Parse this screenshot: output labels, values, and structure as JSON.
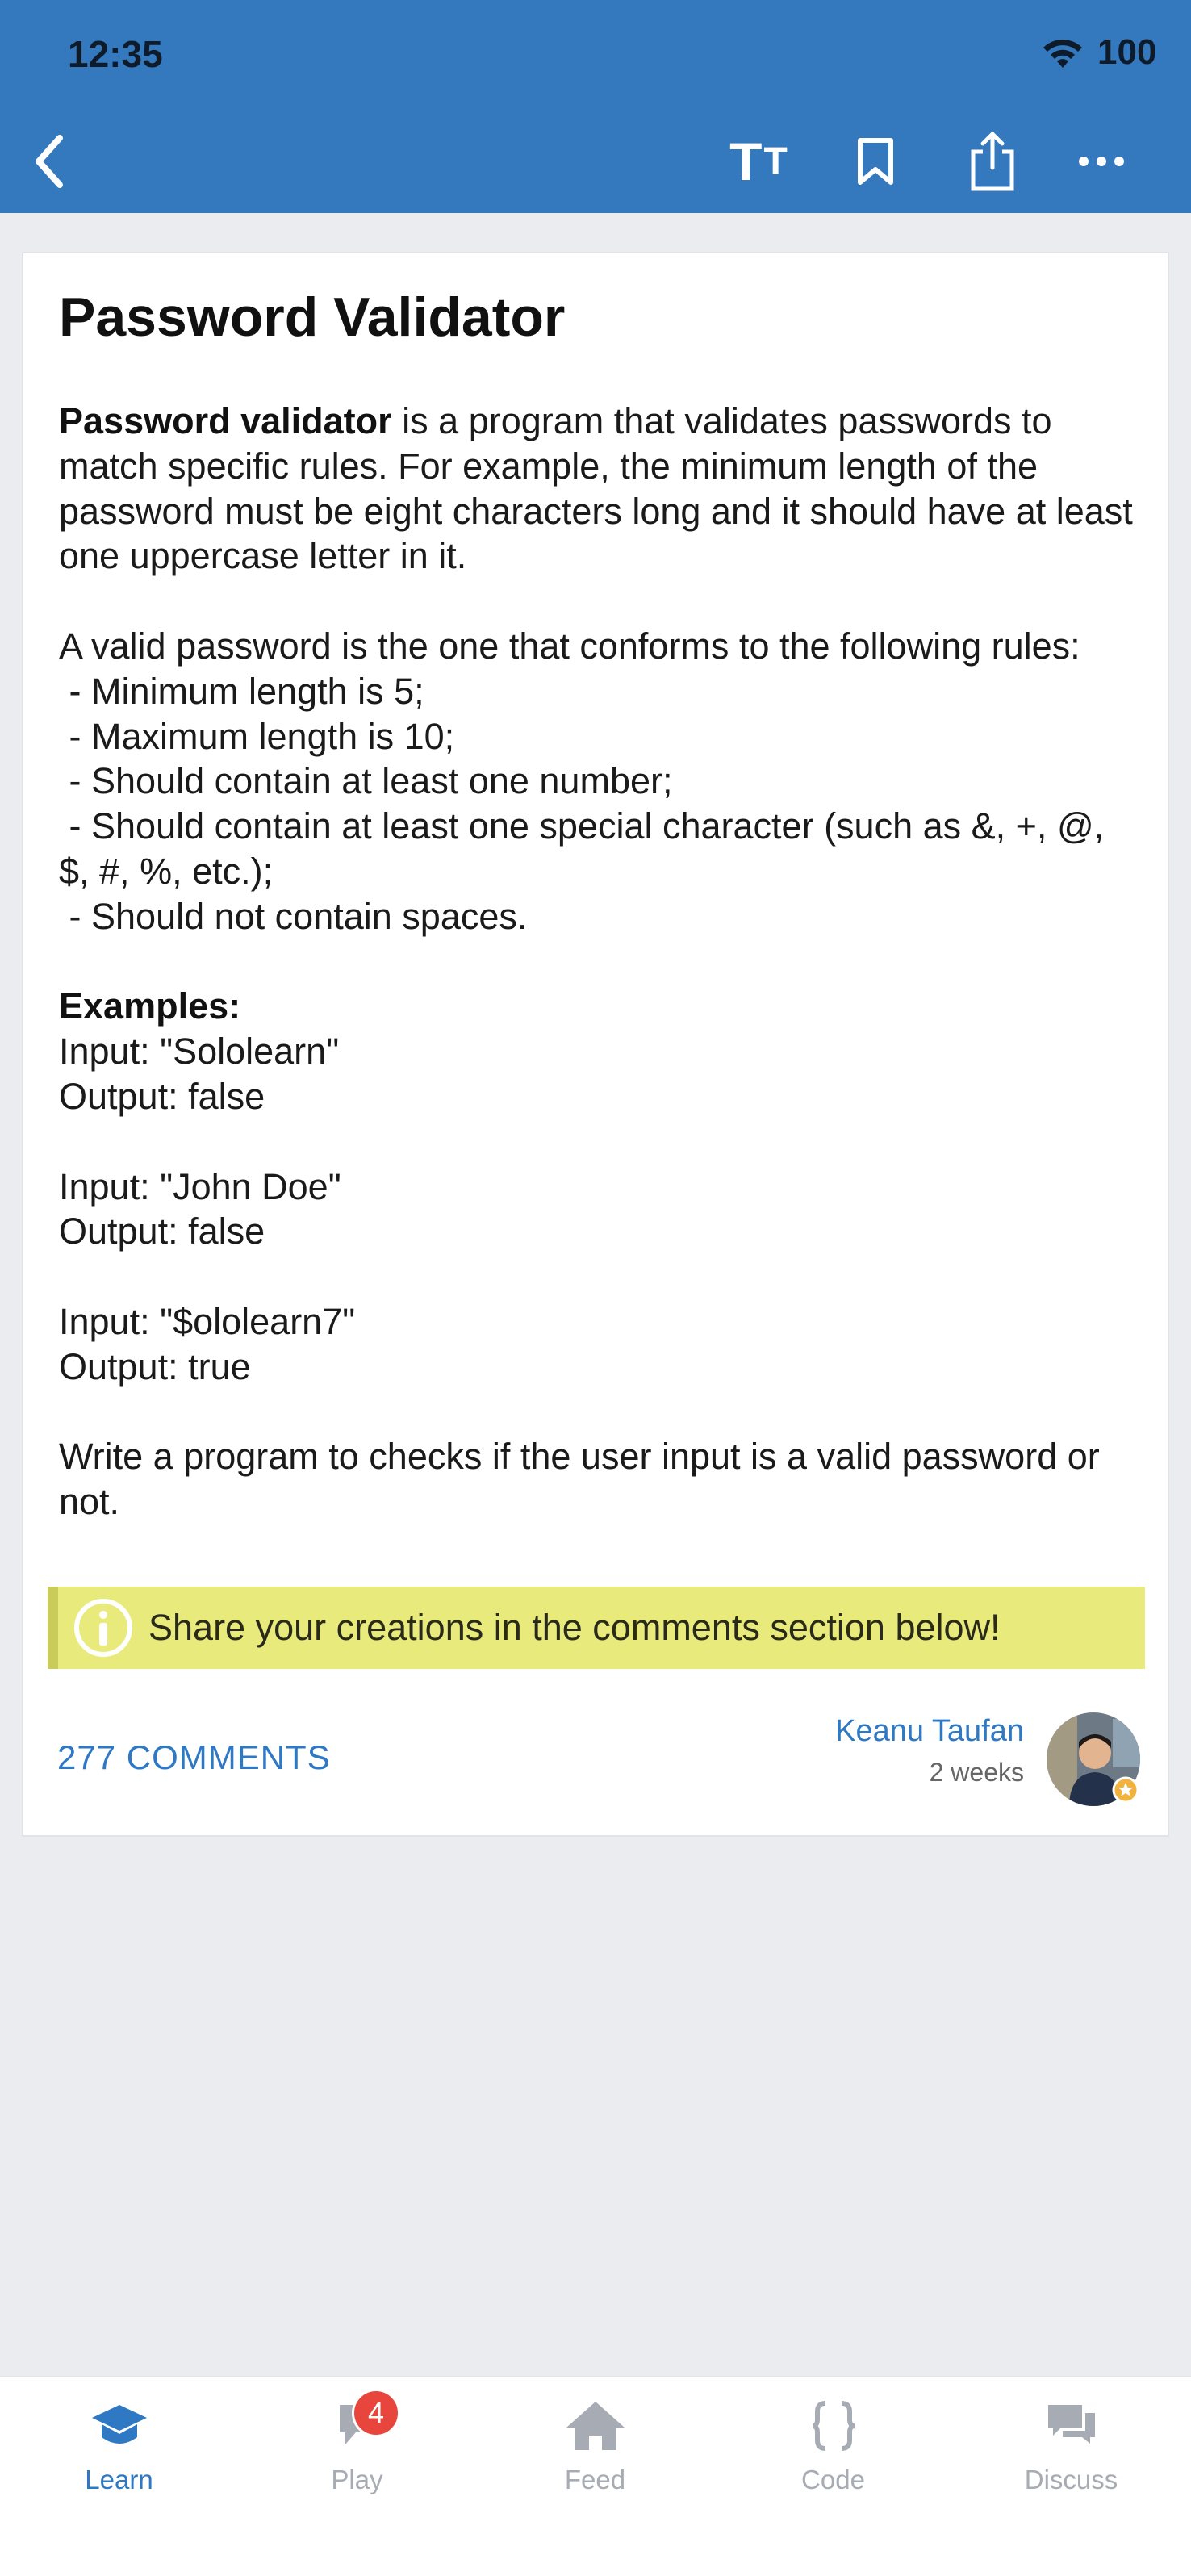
{
  "status": {
    "time": "12:35",
    "battery": "100"
  },
  "toolbar": {
    "font_label_big": "T",
    "font_label_small": "T"
  },
  "article": {
    "title": "Password Validator",
    "intro_bold": "Password validator",
    "intro_rest": " is a program that validates passwords to match specific rules. For example, the minimum length of the password must be eight characters long and it should have at least one uppercase letter in it.",
    "rules_intro": "A valid password is the one that conforms to the following rules:",
    "rules": [
      " - Minimum length is 5;",
      " - Maximum length is 10;",
      " - Should contain at least one number;",
      " - Should contain at least one special character (such as &, +, @, $, #, %, etc.);",
      " - Should not contain spaces."
    ],
    "examples_label": "Examples:",
    "examples": [
      {
        "input": "Input: \"Sololearn\"",
        "output": "Output: false"
      },
      {
        "input": "Input: \"John Doe\"",
        "output": "Output: false"
      },
      {
        "input": "Input: \"$ololearn7\"",
        "output": "Output: true"
      }
    ],
    "task": "Write a program to checks if the user input is a valid password or not."
  },
  "tip": {
    "text": "Share your creations in the comments section below!"
  },
  "footer": {
    "comments": "277 COMMENTS",
    "author": "Keanu Taufan",
    "ago": "2 weeks"
  },
  "tabs": [
    {
      "label": "Learn",
      "icon": "graduation-cap-icon",
      "active": true
    },
    {
      "label": "Play",
      "icon": "play-flag-icon",
      "badge": "4"
    },
    {
      "label": "Feed",
      "icon": "home-icon"
    },
    {
      "label": "Code",
      "icon": "braces-icon"
    },
    {
      "label": "Discuss",
      "icon": "chat-bubbles-icon"
    }
  ],
  "colors": {
    "header": "#3478be",
    "accent": "#2f78c4",
    "tip_bg": "#e8ea7c",
    "badge": "#e8463c"
  }
}
